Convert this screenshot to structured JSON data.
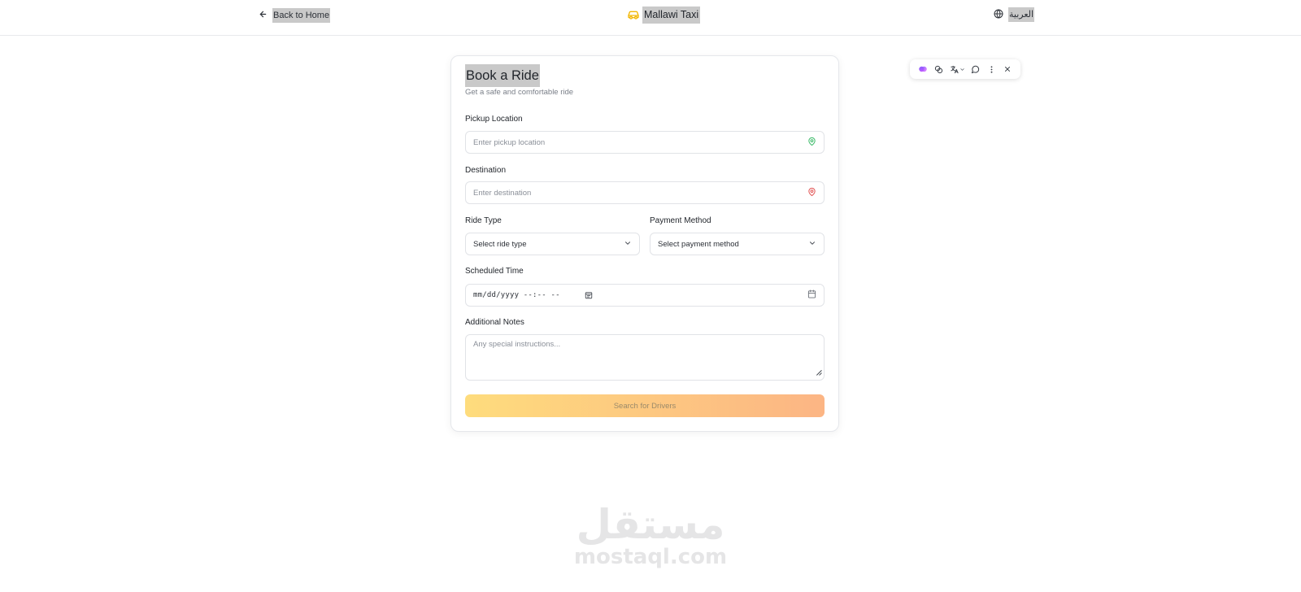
{
  "header": {
    "back_label": "Back to Home",
    "brand_name": "Mallawi Taxi",
    "language_label": "العربية"
  },
  "form": {
    "title": "Book a Ride",
    "subtitle": "Get a safe and comfortable ride",
    "pickup": {
      "label": "Pickup Location",
      "placeholder": "Enter pickup location"
    },
    "destination": {
      "label": "Destination",
      "placeholder": "Enter destination"
    },
    "ride_type": {
      "label": "Ride Type",
      "value": "Select ride type"
    },
    "payment_method": {
      "label": "Payment Method",
      "value": "Select payment method"
    },
    "scheduled_time": {
      "label": "Scheduled Time",
      "value": "mm/dd/yyyy --:-- --"
    },
    "notes": {
      "label": "Additional Notes",
      "placeholder": "Any special instructions..."
    },
    "submit_label": "Search for Drivers"
  },
  "colors": {
    "pickup_pin": "#3dbb6a",
    "destination_pin": "#e25555",
    "brand_icon": "#f2b705",
    "button_gradient_start": "#fedc7d",
    "button_gradient_end": "#fcb584"
  },
  "icons": {
    "back": "arrow-left-icon",
    "brand": "car-icon",
    "language": "globe-icon",
    "pickup": "map-pin-icon",
    "destination": "map-pin-icon",
    "select": "chevron-down-icon",
    "calendar": "calendar-icon"
  },
  "watermark": {
    "arabic": "مستقل",
    "latin": "mostaql.com"
  }
}
